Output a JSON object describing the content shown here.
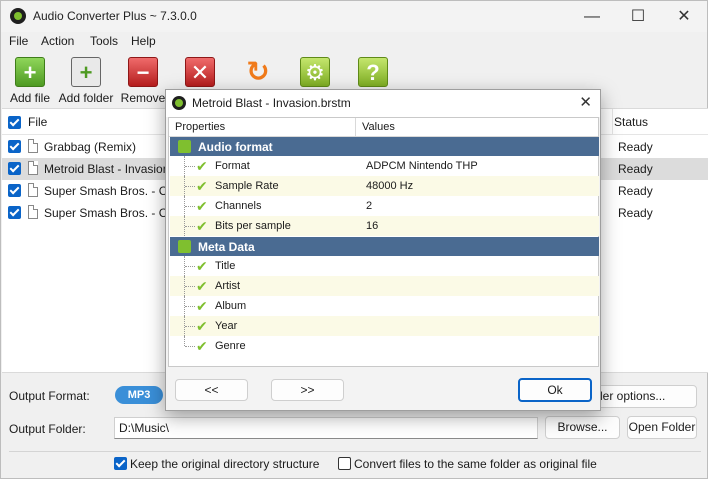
{
  "app": {
    "title": "Audio Converter Plus ~ 7.3.0.0",
    "controls": {
      "minimize": "—",
      "maximize": "☐",
      "close": "✕"
    }
  },
  "menu": [
    "File",
    "Action",
    "Tools",
    "Help"
  ],
  "toolbar": {
    "add_file": "Add file",
    "add_folder": "Add folder",
    "remove": "Remove"
  },
  "list": {
    "columns": {
      "file": "File",
      "status": "Status"
    },
    "rows": [
      {
        "name": "Grabbag (Remix)",
        "status": "Ready"
      },
      {
        "name": "Metroid Blast - Invasion",
        "status": "Ready"
      },
      {
        "name": "Super Smash Bros. - Char",
        "status": "Ready"
      },
      {
        "name": "Super Smash Bros. - Char",
        "status": "Ready"
      }
    ]
  },
  "bottom": {
    "output_format_label": "Output Format:",
    "format_value": "MP3",
    "encoder_options": "der options...",
    "output_folder_label": "Output Folder:",
    "folder_value": "D:\\Music\\",
    "browse": "Browse...",
    "open_folder": "Open Folder",
    "keep_structure": "Keep the original directory structure",
    "same_folder": "Convert files to the same folder as original file"
  },
  "dialog": {
    "title": "Metroid Blast - Invasion.brstm",
    "close": "✕",
    "col_properties": "Properties",
    "col_values": "Values",
    "groups": [
      {
        "label": "Audio format",
        "items": [
          {
            "name": "Format",
            "value": "ADPCM Nintendo THP"
          },
          {
            "name": "Sample Rate",
            "value": "48000 Hz"
          },
          {
            "name": "Channels",
            "value": "2"
          },
          {
            "name": "Bits per sample",
            "value": "16"
          }
        ]
      },
      {
        "label": "Meta Data",
        "items": [
          {
            "name": "Title",
            "value": ""
          },
          {
            "name": "Artist",
            "value": ""
          },
          {
            "name": "Album",
            "value": ""
          },
          {
            "name": "Year",
            "value": ""
          },
          {
            "name": "Genre",
            "value": ""
          }
        ]
      }
    ],
    "prev": "<<",
    "next": ">>",
    "ok": "Ok"
  }
}
